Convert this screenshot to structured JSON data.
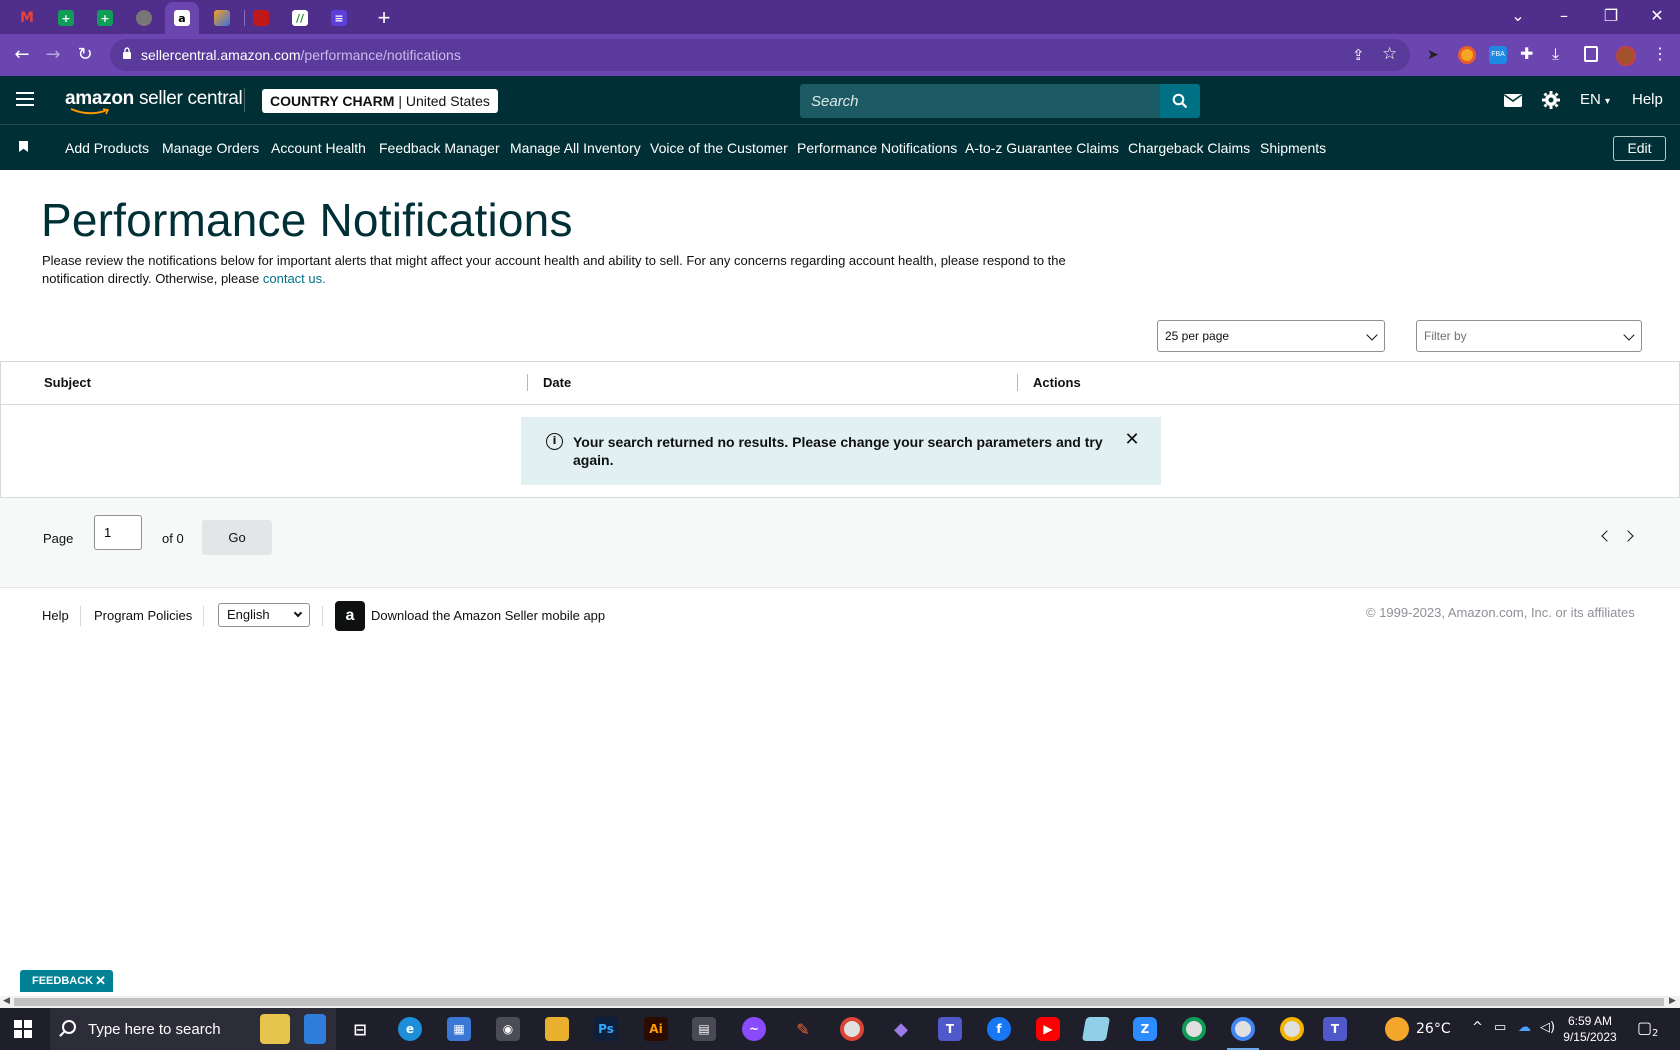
{
  "browser": {
    "url_host": "sellercentral.amazon.com",
    "url_path": "/performance/notifications",
    "tab_favicons": [
      "gmail",
      "google-sheets",
      "google-sheets",
      "globe",
      "amazon",
      "stripe-like",
      "mcafee",
      "notion-like",
      "tasks"
    ],
    "colors": {
      "frame": "#4f2e8c",
      "toolbar": "#6b45b0"
    }
  },
  "header": {
    "logo_brand": "amazon",
    "logo_product": "seller central",
    "store_name": "COUNTRY CHARM",
    "store_region": "United States",
    "search_placeholder": "Search",
    "language": "EN",
    "help_label": "Help"
  },
  "nav": {
    "links": [
      "Add Products",
      "Manage Orders",
      "Account Health",
      "Feedback Manager",
      "Manage All Inventory",
      "Voice of the Customer",
      "Performance Notifications",
      "A-to-z Guarantee Claims",
      "Chargeback Claims",
      "Shipments"
    ],
    "edit_label": "Edit"
  },
  "page": {
    "title": "Performance Notifications",
    "intro_text": "Please review the notifications below for important alerts that might affect your account health and ability to sell. For any concerns regarding account health, please respond to the notification directly. Otherwise, please ",
    "intro_link": "contact us.",
    "per_page": "25 per page",
    "filter_placeholder": "Filter by"
  },
  "table": {
    "columns": [
      "Subject",
      "Date",
      "Actions"
    ],
    "alert_message": "Your search returned no results. Please change your search parameters and try again."
  },
  "pager": {
    "page_label": "Page",
    "current_page": "1",
    "of_label": "of 0",
    "go_label": "Go"
  },
  "footer": {
    "help": "Help",
    "program_policies": "Program Policies",
    "language": "English",
    "app_download": "Download the Amazon Seller mobile app",
    "copyright": "© 1999-2023, Amazon.com, Inc. or its affiliates"
  },
  "feedback_label": "FEEDBACK",
  "taskbar": {
    "search_placeholder": "Type here to search",
    "temperature": "26°C",
    "time": "6:59 AM",
    "date": "9/15/2023",
    "notification_count": "2"
  }
}
